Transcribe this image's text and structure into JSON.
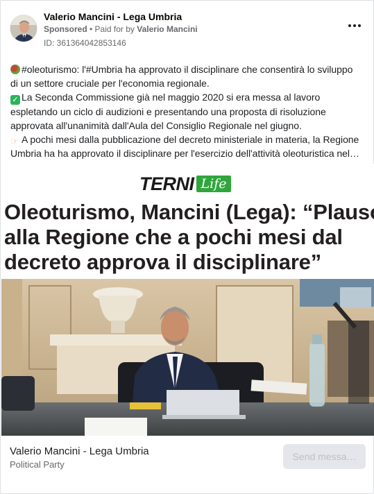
{
  "post": {
    "page_name": "Valerio Mancini - Lega Umbria",
    "sponsored": "Sponsored",
    "paid_prefix": "• Paid for by",
    "payer": "Valerio Mancini",
    "ad_id": "ID: 361364042853146",
    "more_icon": "more-horizontal-icon",
    "lines": [
      "#oleoturismo: l'#Umbria ha approvato il disciplinare che consentirà lo sviluppo",
      "di un settore cruciale per l'economia regionale.",
      "La Seconda Commissione già nel maggio 2020 si era messa al lavoro",
      "espletando un ciclo di audizioni e presentando una proposta di risoluzione",
      "approvata all'unanimità dall'Aula del Consiglio Regionale nel giugno.",
      "A pochi mesi dalla pubblicazione del decreto ministeriale in materia, la Regione",
      "Umbria ha ha approvato il disciplinare per l'esercizio dell'attività oleoturistica nel…"
    ],
    "line_icons": [
      "apple-emoji-icon",
      "check-mark-emoji-icon",
      "pointing-hand-emoji-icon"
    ]
  },
  "media": {
    "logo_main": "TERNI",
    "logo_accent": "Life",
    "headline": [
      "Oleoturismo, Mancini (Lega): “Plauso",
      "alla Regione che a pochi mesi dal",
      "decreto approva il disciplinare”"
    ],
    "colors": {
      "logo_green": "#2fa63c",
      "headline": "#231f20"
    }
  },
  "footer": {
    "page_name": "Valerio Mancini - Lega Umbria",
    "category": "Political Party",
    "send_label": "Send messa…"
  }
}
